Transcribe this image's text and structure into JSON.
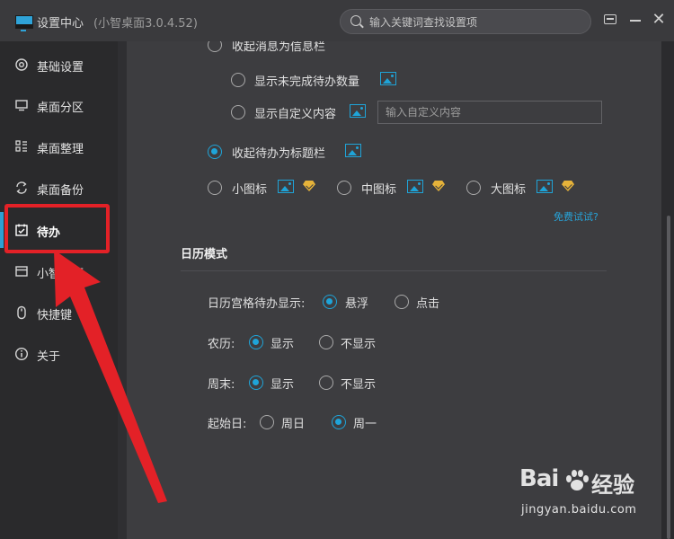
{
  "window": {
    "title": "设置中心",
    "version": "(小智桌面3.0.4.52)",
    "search_placeholder": "输入关键词查找设置项",
    "close_glyph": "✕"
  },
  "sidebar": {
    "items": [
      {
        "label": "基础设置",
        "icon": "gear-icon"
      },
      {
        "label": "桌面分区",
        "icon": "monitor-icon"
      },
      {
        "label": "桌面整理",
        "icon": "grid-icon"
      },
      {
        "label": "桌面备份",
        "icon": "sync-icon"
      },
      {
        "label": "待办",
        "icon": "calendar-check-icon",
        "active": true
      },
      {
        "label": "小智日历",
        "icon": "window-icon"
      },
      {
        "label": "快捷键",
        "icon": "mouse-icon"
      },
      {
        "label": "关于",
        "icon": "info-icon"
      }
    ]
  },
  "todo_settings": {
    "collapse_to_message_bar": "收起消息为信息栏",
    "show_unfinished_count": "显示未完成待办数量",
    "show_custom_content": "显示自定义内容",
    "custom_content_placeholder": "输入自定义内容",
    "collapse_to_title_bar": "收起待办为标题栏",
    "size_small": "小图标",
    "size_medium": "中图标",
    "size_large": "大图标",
    "free_trial": "免费试试?"
  },
  "calendar": {
    "section_title": "日历模式",
    "grid_todo_label": "日历宫格待办显示:",
    "grid_hover": "悬浮",
    "grid_click": "点击",
    "lunar_label": "农历:",
    "weekend_label": "周末:",
    "show": "显示",
    "hide": "不显示",
    "week_start_label": "起始日:",
    "sunday": "周日",
    "monday": "周一"
  },
  "watermark": {
    "brand": "Bai",
    "cn": "经验",
    "url": "jingyan.baidu.com"
  },
  "colors": {
    "accent": "#1fa4d8",
    "annotation": "#e32127",
    "vip": "#e6b33a"
  }
}
